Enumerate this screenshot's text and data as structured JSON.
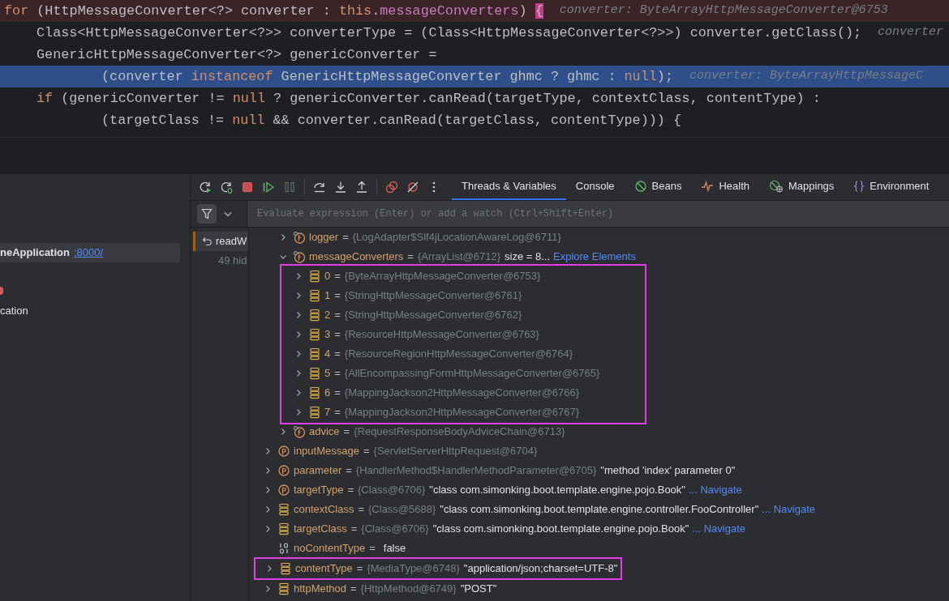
{
  "editor": {
    "lines": [
      {
        "breakpoint": true,
        "current": false,
        "tokens": [
          {
            "kind": "kw",
            "s": "for"
          },
          {
            "kind": "plain",
            "s": " (HttpMessageConverter<?> converter : "
          },
          {
            "kind": "kw",
            "s": "this"
          },
          {
            "kind": "plain",
            "s": "."
          },
          {
            "kind": "field",
            "s": "messageConverters"
          },
          {
            "kind": "plain",
            "s": ") "
          },
          {
            "kind": "brace",
            "s": "{"
          }
        ],
        "hint": "converter: ByteArrayHttpMessageConverter@6753",
        "children": [
          {
            "breakpoint": false,
            "current": false,
            "tokens": [
              {
                "kind": "plain",
                "s": "Class<HttpMessageConverter<?>> converterType = (Class<HttpMessageConverter<?>>) converter.getClass();"
              }
            ],
            "hint": "converter"
          },
          {
            "breakpoint": false,
            "current": false,
            "tokens": [
              {
                "kind": "plain",
                "s": "GenericHttpMessageConverter<?> genericConverter ="
              }
            ],
            "children": [
              {
                "breakpoint": false,
                "current": true,
                "tokens": [
                  {
                    "kind": "plain",
                    "s": "(converter "
                  },
                  {
                    "kind": "kw",
                    "s": "instanceof"
                  },
                  {
                    "kind": "plain",
                    "s": " GenericHttpMessageConverter ghmc ? ghmc : "
                  },
                  {
                    "kind": "kw",
                    "s": "null"
                  },
                  {
                    "kind": "plain",
                    "s": ");"
                  }
                ],
                "hint": "converter: ByteArrayHttpMessageC"
              }
            ]
          },
          {
            "breakpoint": false,
            "current": false,
            "tokens": [
              {
                "kind": "kw",
                "s": "if"
              },
              {
                "kind": "plain",
                "s": " (genericConverter != "
              },
              {
                "kind": "kw",
                "s": "null"
              },
              {
                "kind": "plain",
                "s": " ? genericConverter.canRead(targetType, contextClass, contentType) :"
              }
            ],
            "children": [
              {
                "breakpoint": false,
                "current": false,
                "tokens": [
                  {
                    "kind": "plain",
                    "s": "(targetClass != "
                  },
                  {
                    "kind": "kw",
                    "s": "null"
                  },
                  {
                    "kind": "plain",
                    "s": " && converter.canRead(targetClass, contentType))) {"
                  }
                ]
              }
            ]
          }
        ]
      }
    ]
  },
  "sidebar": {
    "items": [
      {
        "name": "neApplication",
        "link": ":8000/",
        "selected": true
      }
    ],
    "text": "cation"
  },
  "tabs": [
    {
      "label": "Threads & Variables",
      "kind": "plain",
      "selected": true
    },
    {
      "label": "Console",
      "kind": "plain",
      "selected": false
    },
    {
      "label": "Beans",
      "kind": "beans",
      "selected": false
    },
    {
      "label": "Health",
      "kind": "health",
      "selected": false
    },
    {
      "label": "Mappings",
      "kind": "mappings",
      "selected": false
    },
    {
      "label": "Environment",
      "kind": "environment",
      "selected": false
    }
  ],
  "evaluate": {
    "placeholder": "Evaluate expression (Enter) or add a watch (Ctrl+Shift+Enter)"
  },
  "frames": {
    "items": [
      {
        "label": "readW",
        "selected": true
      }
    ],
    "hidden": "49 hid"
  },
  "variables": {
    "continued_children": [
      {
        "kind": "field",
        "name": "logger",
        "operator": "=",
        "ref": "{LogAdapter$Slf4jLocationAwareLog@6711}",
        "expanded": false
      },
      {
        "kind": "field",
        "name": "messageConverters",
        "operator": "=",
        "ref": "{ArrayList@6712}",
        "text": "size = 8...",
        "link": "Explore Elements",
        "expanded": true,
        "children_boxed": true,
        "children": [
          {
            "kind": "object",
            "name": "0",
            "operator": "=",
            "ref": "{ByteArrayHttpMessageConverter@6753}",
            "expanded": false
          },
          {
            "kind": "object",
            "name": "1",
            "operator": "=",
            "ref": "{StringHttpMessageConverter@6761}",
            "expanded": false
          },
          {
            "kind": "object",
            "name": "2",
            "operator": "=",
            "ref": "{StringHttpMessageConverter@6762}",
            "expanded": false
          },
          {
            "kind": "object",
            "name": "3",
            "operator": "=",
            "ref": "{ResourceHttpMessageConverter@6763}",
            "expanded": false
          },
          {
            "kind": "object",
            "name": "4",
            "operator": "=",
            "ref": "{ResourceRegionHttpMessageConverter@6764}",
            "expanded": false
          },
          {
            "kind": "object",
            "name": "5",
            "operator": "=",
            "ref": "{AllEncompassingFormHttpMessageConverter@6765}",
            "expanded": false
          },
          {
            "kind": "object",
            "name": "6",
            "operator": "=",
            "ref": "{MappingJackson2HttpMessageConverter@6766}",
            "expanded": false
          },
          {
            "kind": "object",
            "name": "7",
            "operator": "=",
            "ref": "{MappingJackson2HttpMessageConverter@6767}",
            "expanded": false
          }
        ]
      },
      {
        "kind": "field",
        "name": "advice",
        "operator": "=",
        "ref": "{RequestResponseBodyAdviceChain@6713}",
        "expanded": false
      }
    ],
    "items": [
      {
        "kind": "parameter",
        "name": "inputMessage",
        "operator": "=",
        "ref": "{ServletServerHttpRequest@6704}",
        "expanded": false
      },
      {
        "kind": "parameter",
        "name": "parameter",
        "operator": "=",
        "ref": "{HandlerMethod$HandlerMethodParameter@6705}",
        "text": "\"method 'index' parameter 0\"",
        "expanded": false
      },
      {
        "kind": "parameter",
        "name": "targetType",
        "operator": "=",
        "ref": "{Class@6706}",
        "text": "\"class com.simonking.boot.template.engine.pojo.Book\"",
        "link": "... Navigate",
        "expanded": false
      },
      {
        "kind": "object",
        "name": "contextClass",
        "operator": "=",
        "ref": "{Class@5688}",
        "text": "\"class com.simonking.boot.template.engine.controller.FooController\"",
        "link": "... Navigate",
        "expanded": false
      },
      {
        "kind": "object",
        "name": "targetClass",
        "operator": "=",
        "ref": "{Class@6706}",
        "text": "\"class com.simonking.boot.template.engine.pojo.Book\"",
        "link": "... Navigate",
        "expanded": false
      },
      {
        "kind": "boolean",
        "name": "noContentType",
        "operator": "=",
        "text": "false"
      },
      {
        "kind": "object",
        "name": "contentType",
        "operator": "=",
        "ref": "{MediaType@6748}",
        "text": "\"application/json;charset=UTF-8\"",
        "expanded": false,
        "boxed": true
      },
      {
        "kind": "object",
        "name": "httpMethod",
        "operator": "=",
        "ref": "{HttpMethod@6749}",
        "text": "\"POST\"",
        "expanded": false
      }
    ]
  }
}
